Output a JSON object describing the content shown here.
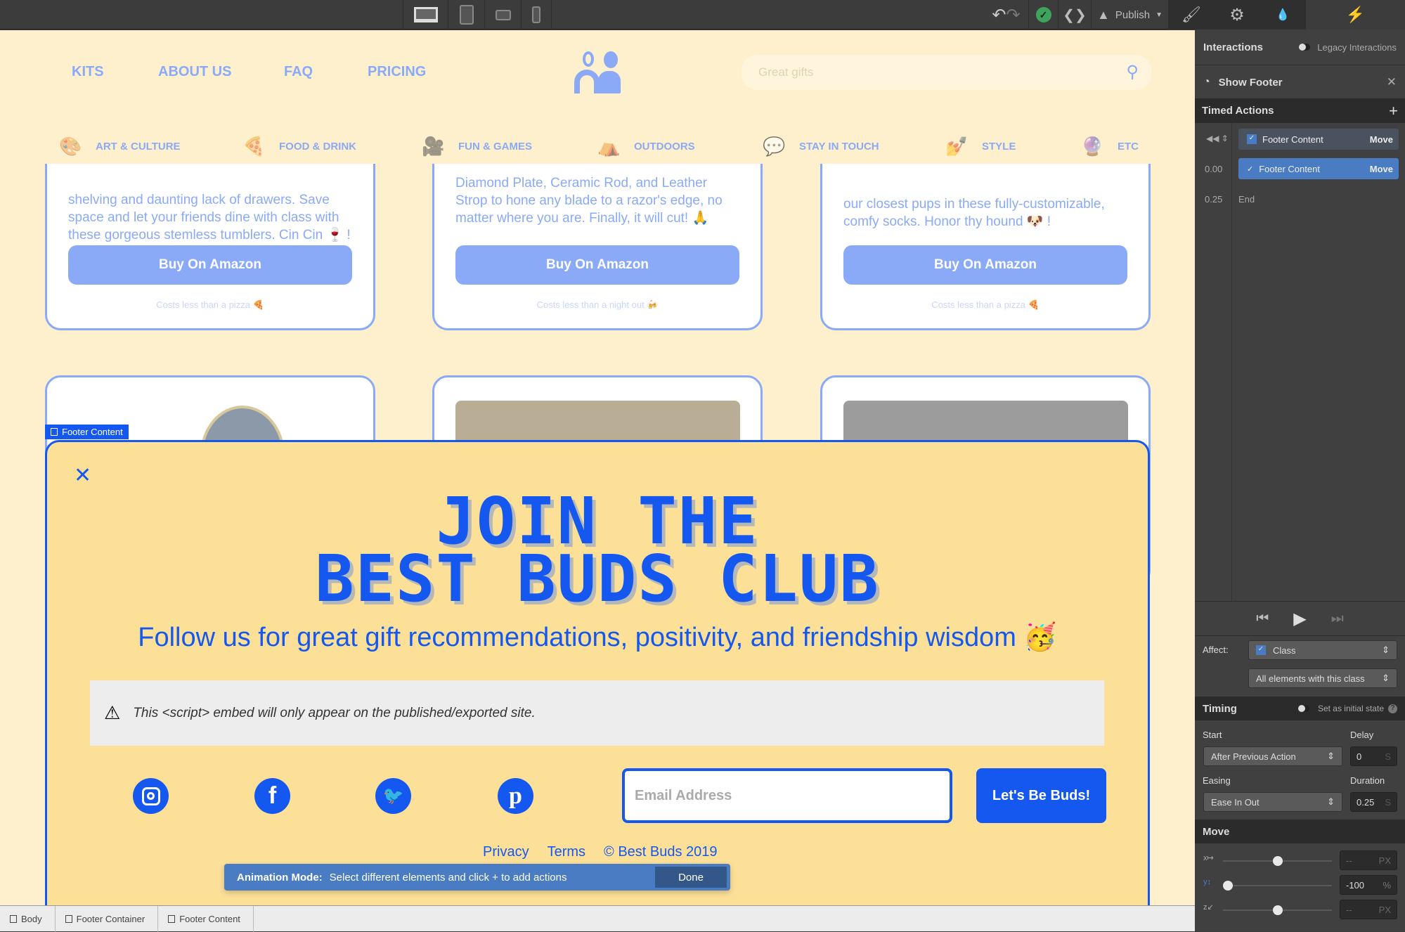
{
  "toolbar": {
    "devices": [
      "desktop-icon",
      "tablet-icon",
      "mobile-landscape-icon",
      "mobile-portrait-icon"
    ],
    "publish_label": "Publish",
    "icons": [
      "undo-icon",
      "redo-icon",
      "check-icon",
      "code-icon",
      "rocket-icon"
    ],
    "panel_tabs": [
      "brush-icon",
      "gear-icon",
      "drops-icon",
      "lightning-icon"
    ]
  },
  "site": {
    "nav": [
      "KITS",
      "ABOUT US",
      "FAQ",
      "PRICING"
    ],
    "search_placeholder": "Great gifts",
    "categories": [
      {
        "label": "ART & CULTURE",
        "icon": "🎨"
      },
      {
        "label": "FOOD & DRINK",
        "icon": "🍕"
      },
      {
        "label": "FUN & GAMES",
        "icon": "🎥"
      },
      {
        "label": "OUTDOORS",
        "icon": "⛺"
      },
      {
        "label": "STAY IN TOUCH",
        "icon": "💬"
      },
      {
        "label": "STYLE",
        "icon": "💅"
      },
      {
        "label": "ETC",
        "icon": "🔮"
      }
    ],
    "cards": [
      {
        "text": "shelving and daunting lack of drawers. Save space and let your friends dine with class with these gorgeous stemless tumblers. Cin Cin 🍷 !",
        "button": "Buy On Amazon",
        "cost": "Costs less than a pizza 🍕"
      },
      {
        "text": "Diamond Plate, Ceramic Rod, and Leather Strop to hone any blade to a razor's edge, no matter where you are. Finally, it will cut! 🙏",
        "button": "Buy On Amazon",
        "cost": "Costs less than a night out 🍻"
      },
      {
        "text": "our closest pups in these fully-customizable, comfy socks. Honor thy hound 🐶 !",
        "button": "Buy On Amazon",
        "cost": "Costs less than a pizza 🍕"
      }
    ]
  },
  "footer": {
    "selection_label": "Footer Content",
    "title_line1": "JOIN THE",
    "title_line2": "BEST BUDS CLUB",
    "subtitle": "Follow us for great gift recommendations, positivity, and friendship wisdom 🥳",
    "embed_notice": "This <script> embed will only appear on the published/exported site.",
    "email_placeholder": "Email Address",
    "submit_label": "Let's Be Buds!",
    "links": [
      "Privacy",
      "Terms",
      "© Best Buds 2019"
    ],
    "social": [
      "instagram-icon",
      "facebook-icon",
      "twitter-icon",
      "pinterest-icon"
    ]
  },
  "animation_bar": {
    "label": "Animation Mode:",
    "message": "Select different elements and click + to add actions",
    "done": "Done"
  },
  "breadcrumb": [
    "Body",
    "Footer Container",
    "Footer Content"
  ],
  "panel": {
    "title": "Interactions",
    "legacy_label": "Legacy Interactions",
    "legacy_on": false,
    "interaction_name": "Show Footer",
    "timed_actions_label": "Timed Actions",
    "actions": [
      {
        "time": "",
        "target": "Footer Content",
        "type": "Move"
      },
      {
        "time": "0.00",
        "target": "Footer Content",
        "type": "Move"
      }
    ],
    "end_time": "0.25",
    "end_label": "End",
    "affect_label": "Affect:",
    "affect_value": "Class",
    "affect_scope": "All elements with this class",
    "timing_label": "Timing",
    "initial_state_label": "Set as initial state",
    "initial_state_on": false,
    "start_label": "Start",
    "start_value": "After Previous Action",
    "delay_label": "Delay",
    "delay_value": "0",
    "delay_unit": "S",
    "easing_label": "Easing",
    "easing_value": "Ease In Out",
    "duration_label": "Duration",
    "duration_value": "0.25",
    "duration_unit": "S",
    "move_label": "Move",
    "move": [
      {
        "axis": "X",
        "value": "--",
        "unit": "PX"
      },
      {
        "axis": "Y",
        "value": "-100",
        "unit": "%"
      },
      {
        "axis": "Z",
        "value": "--",
        "unit": "PX"
      }
    ]
  },
  "colors": {
    "accent": "#1558f0",
    "canvas": "#fef0cc",
    "footer_bg": "#fce097",
    "panel": "#404040",
    "faded_blue": "#8aaaf8",
    "selected_action": "#4a7cc4"
  }
}
